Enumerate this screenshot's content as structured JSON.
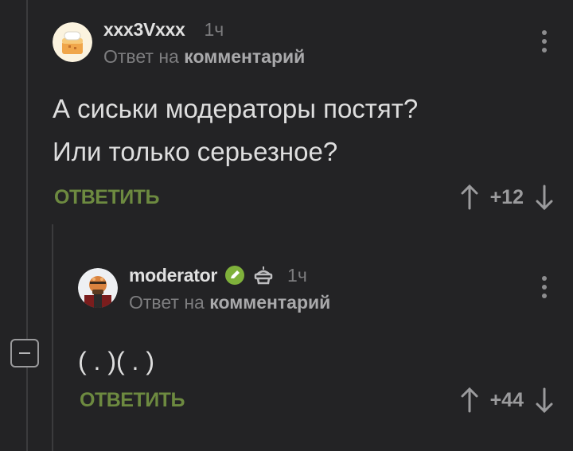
{
  "comments": [
    {
      "username": "xxx3Vxxx",
      "time": "1ч",
      "reply_prefix": "Ответ на",
      "reply_target": "комментарий",
      "text_lines": [
        "А сиськи модераторы постят?",
        "Или только серьезное?"
      ],
      "reply_label": "ОТВЕТИТЬ",
      "rating": "+12"
    },
    {
      "username": "moderator",
      "time": "1ч",
      "reply_prefix": "Ответ на",
      "reply_target": "комментарий",
      "text_lines": [
        "( . )( . )"
      ],
      "reply_label": "ОТВЕТИТЬ",
      "rating": "+44"
    }
  ],
  "colors": {
    "background": "#232325",
    "accent_green": "#6d8a40",
    "verified_green": "#7fb13b",
    "muted": "#7d7d7f"
  },
  "icons": [
    "avatar-cake-icon",
    "verified-icon",
    "cake-icon",
    "more-vertical-icon",
    "arrow-up-icon",
    "arrow-down-icon",
    "minus-icon"
  ]
}
